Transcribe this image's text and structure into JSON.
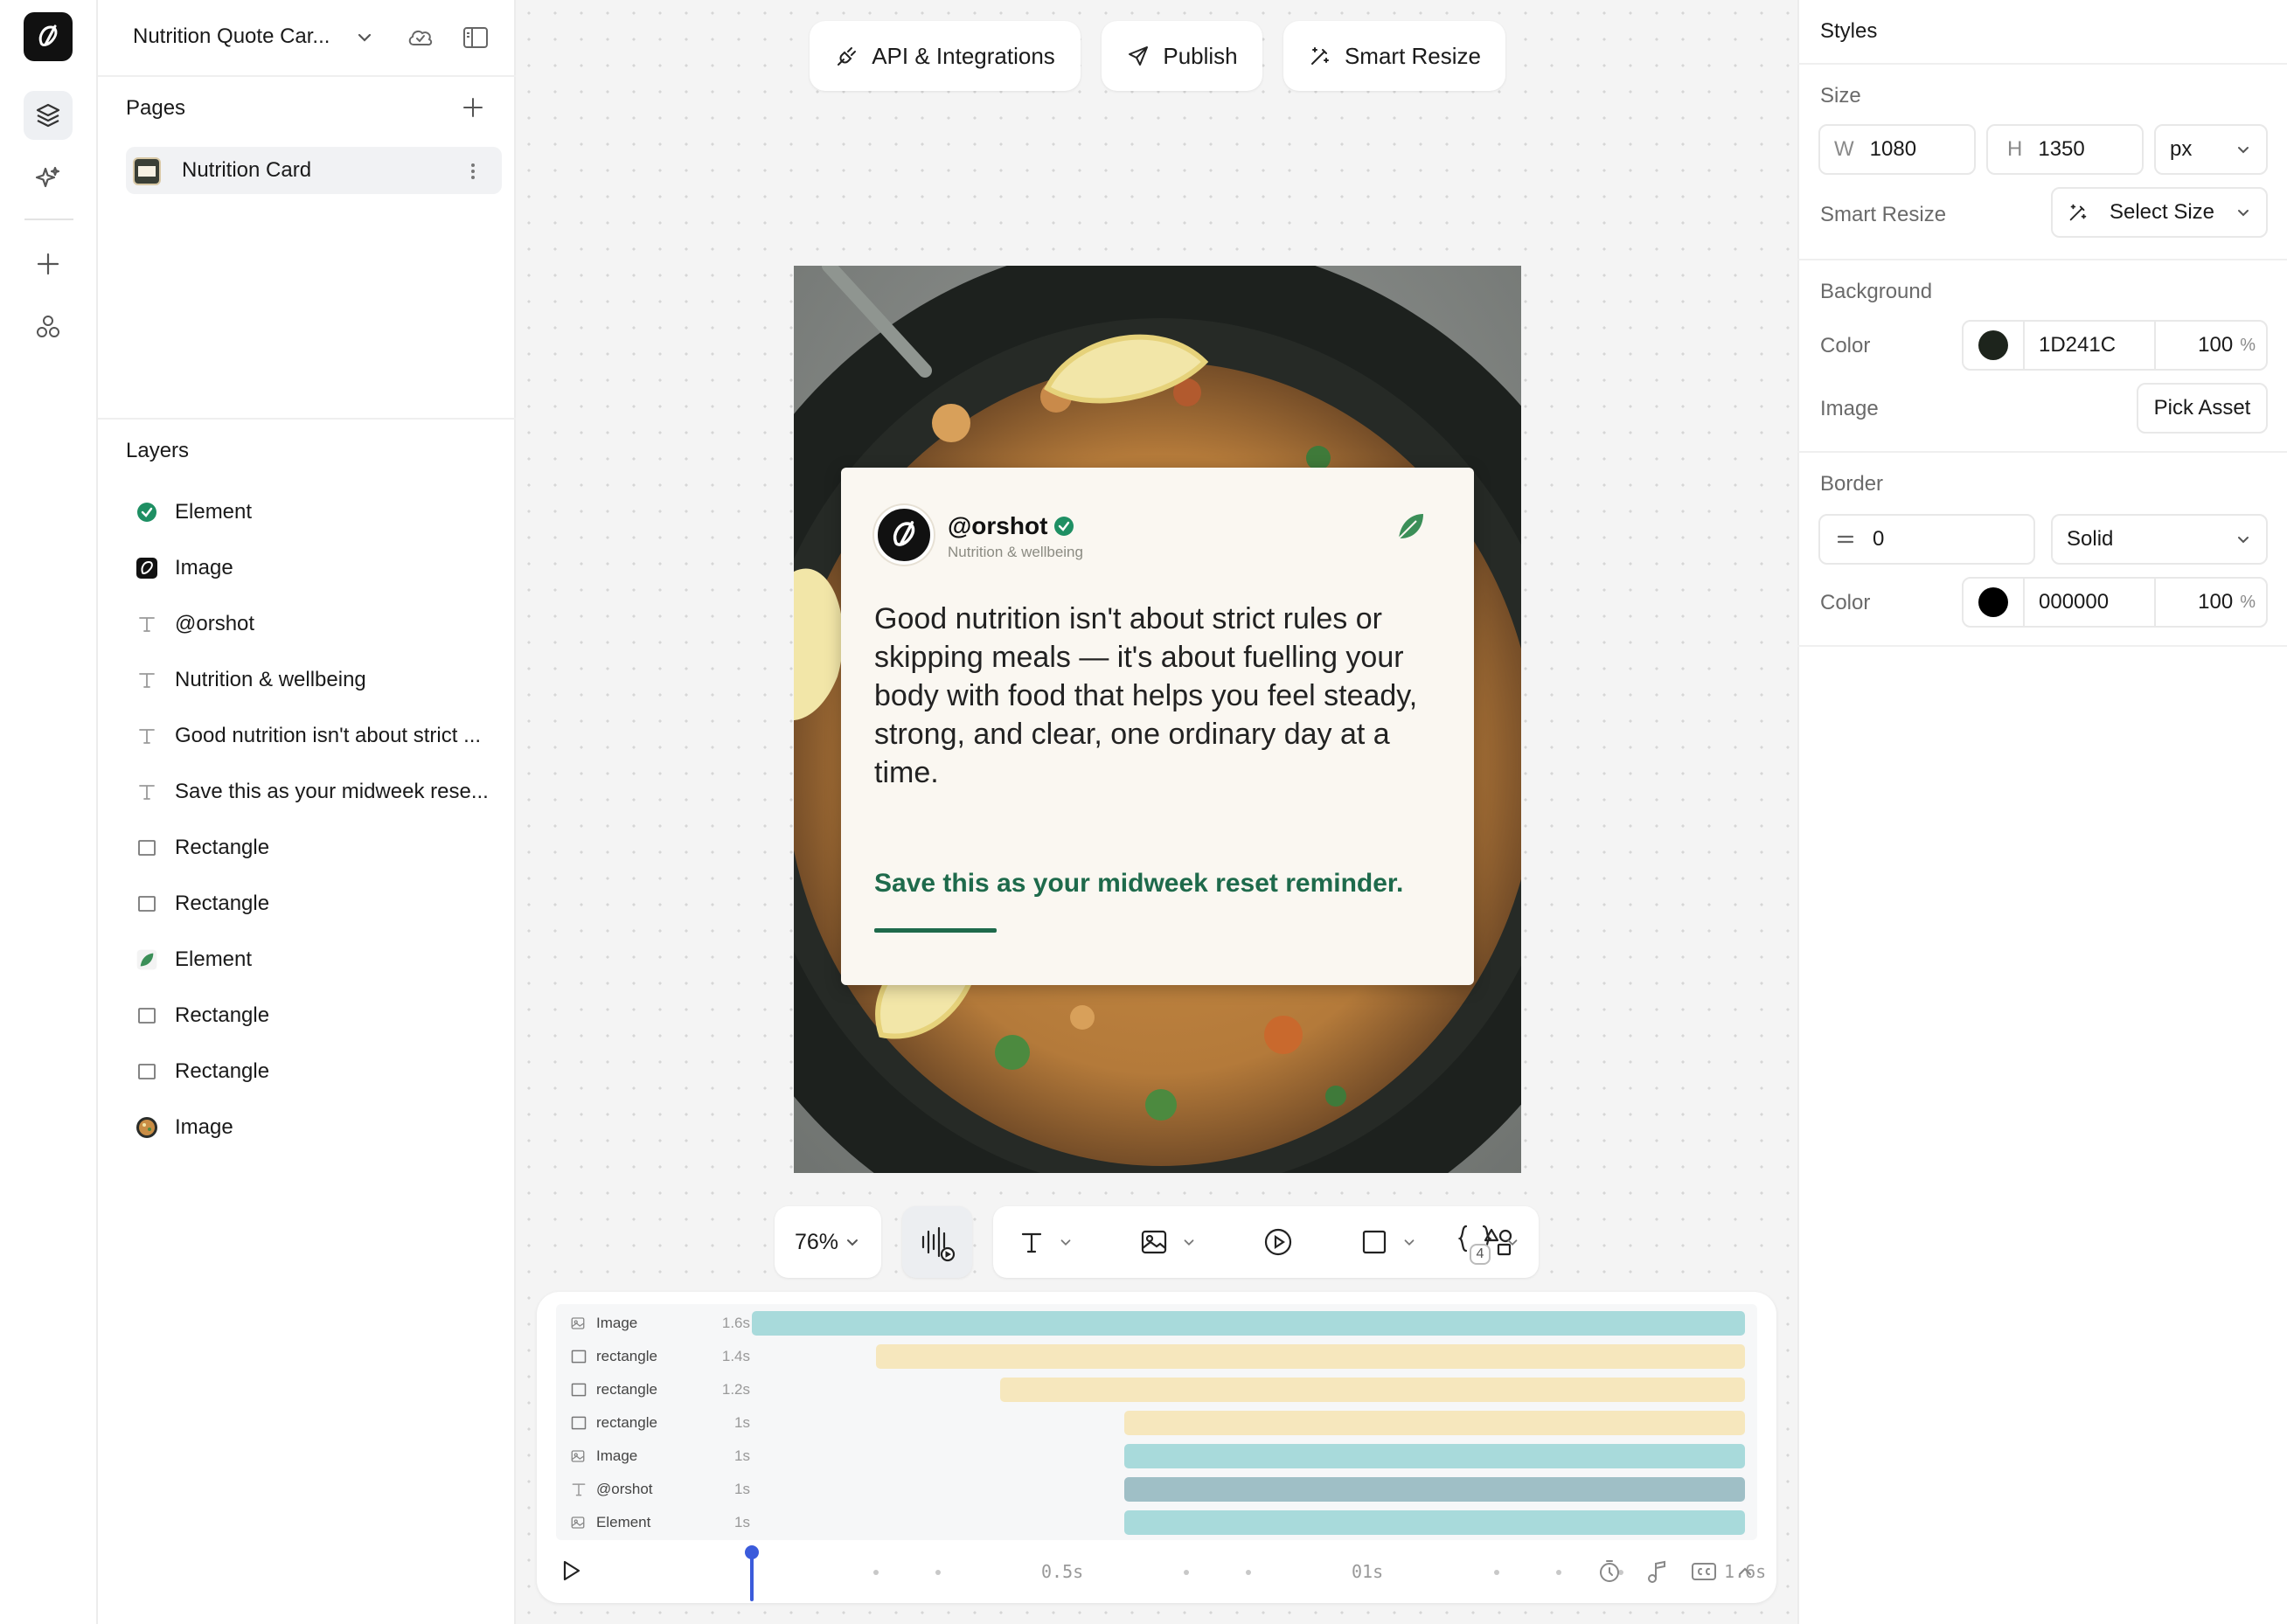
{
  "project": {
    "title": "Nutrition Quote Car..."
  },
  "pages": {
    "title": "Pages",
    "items": [
      {
        "label": "Nutrition Card"
      }
    ]
  },
  "layers": {
    "title": "Layers",
    "items": [
      {
        "label": "Element",
        "icon": "verified-badge-icon"
      },
      {
        "label": "Image",
        "icon": "logo-image-icon"
      },
      {
        "label": "@orshot",
        "icon": "text-icon"
      },
      {
        "label": "Nutrition & wellbeing",
        "icon": "text-icon"
      },
      {
        "label": "Good nutrition isn't about strict ...",
        "icon": "text-icon"
      },
      {
        "label": "Save this as your midweek rese...",
        "icon": "text-icon"
      },
      {
        "label": "Rectangle",
        "icon": "rectangle-icon"
      },
      {
        "label": "Rectangle",
        "icon": "rectangle-icon"
      },
      {
        "label": "Element",
        "icon": "leaf-icon"
      },
      {
        "label": "Rectangle",
        "icon": "rectangle-icon"
      },
      {
        "label": "Rectangle",
        "icon": "rectangle-icon"
      },
      {
        "label": "Image",
        "icon": "food-image-icon"
      }
    ]
  },
  "toolbar": {
    "api_label": "API & Integrations",
    "publish_label": "Publish",
    "smart_resize_label": "Smart Resize"
  },
  "card": {
    "handle": "@orshot",
    "subtitle": "Nutrition & wellbeing",
    "quote": "Good nutrition isn't about strict rules or skipping meals — it's about fuelling your body with food that helps you feel steady, strong, and clear, one ordinary day at a time.",
    "cta": "Save this as your midweek reset reminder."
  },
  "bottom_tools": {
    "zoom": "76%",
    "variables_count": "4"
  },
  "timeline": {
    "rows": [
      {
        "label": "Image",
        "icon": "image-icon",
        "duration": "1.6s",
        "start": 0.0,
        "end": 1.6,
        "color": "#a8dadb"
      },
      {
        "label": "rectangle",
        "icon": "rectangle-icon",
        "duration": "1.4s",
        "start": 0.2,
        "end": 1.6,
        "color": "#f6e7bd"
      },
      {
        "label": "rectangle",
        "icon": "rectangle-icon",
        "duration": "1.2s",
        "start": 0.4,
        "end": 1.6,
        "color": "#f6e7bd"
      },
      {
        "label": "rectangle",
        "icon": "rectangle-icon",
        "duration": "1s",
        "start": 0.6,
        "end": 1.6,
        "color": "#f6e7bd"
      },
      {
        "label": "Image",
        "icon": "image-icon",
        "duration": "1s",
        "start": 0.6,
        "end": 1.6,
        "color": "#a8dadb"
      },
      {
        "label": "@orshot",
        "icon": "text-icon",
        "duration": "1s",
        "start": 0.6,
        "end": 1.6,
        "color": "#9fbfc6"
      },
      {
        "label": "Element",
        "icon": "image-icon",
        "duration": "1s",
        "start": 0.6,
        "end": 1.6,
        "color": "#a8dadb"
      }
    ],
    "ticks": [
      "0.5s",
      "01s",
      "1.6s"
    ],
    "total": 1.6,
    "playhead": 0.0
  },
  "styles": {
    "title": "Styles",
    "size": {
      "title": "Size",
      "w_label": "W",
      "w": "1080",
      "h_label": "H",
      "h": "1350",
      "unit": "px"
    },
    "smart_resize": {
      "label": "Smart Resize",
      "button": "Select Size"
    },
    "background": {
      "title": "Background",
      "color_label": "Color",
      "color": "1D241C",
      "opacity": "100",
      "pct": "%",
      "image_label": "Image",
      "pick_asset": "Pick Asset",
      "swatch": "#1D241C"
    },
    "border": {
      "title": "Border",
      "width": "0",
      "style": "Solid",
      "color_label": "Color",
      "color": "000000",
      "opacity": "100",
      "pct": "%",
      "swatch": "#000000"
    }
  }
}
